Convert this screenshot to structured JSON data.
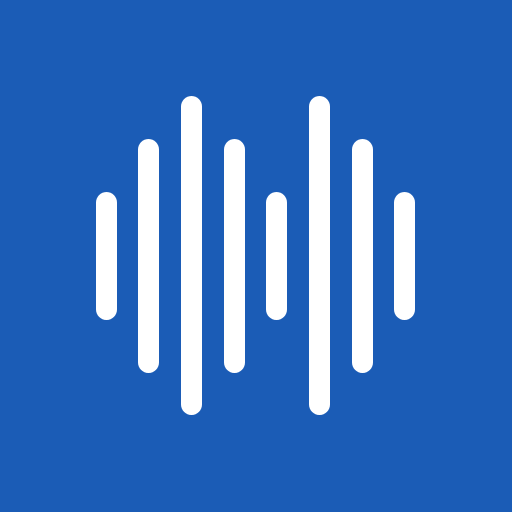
{
  "icon": {
    "name": "sound-waveform-icon",
    "background_color": "#1b5cb6",
    "bar_color": "#ffffff",
    "bar_count": 8
  }
}
